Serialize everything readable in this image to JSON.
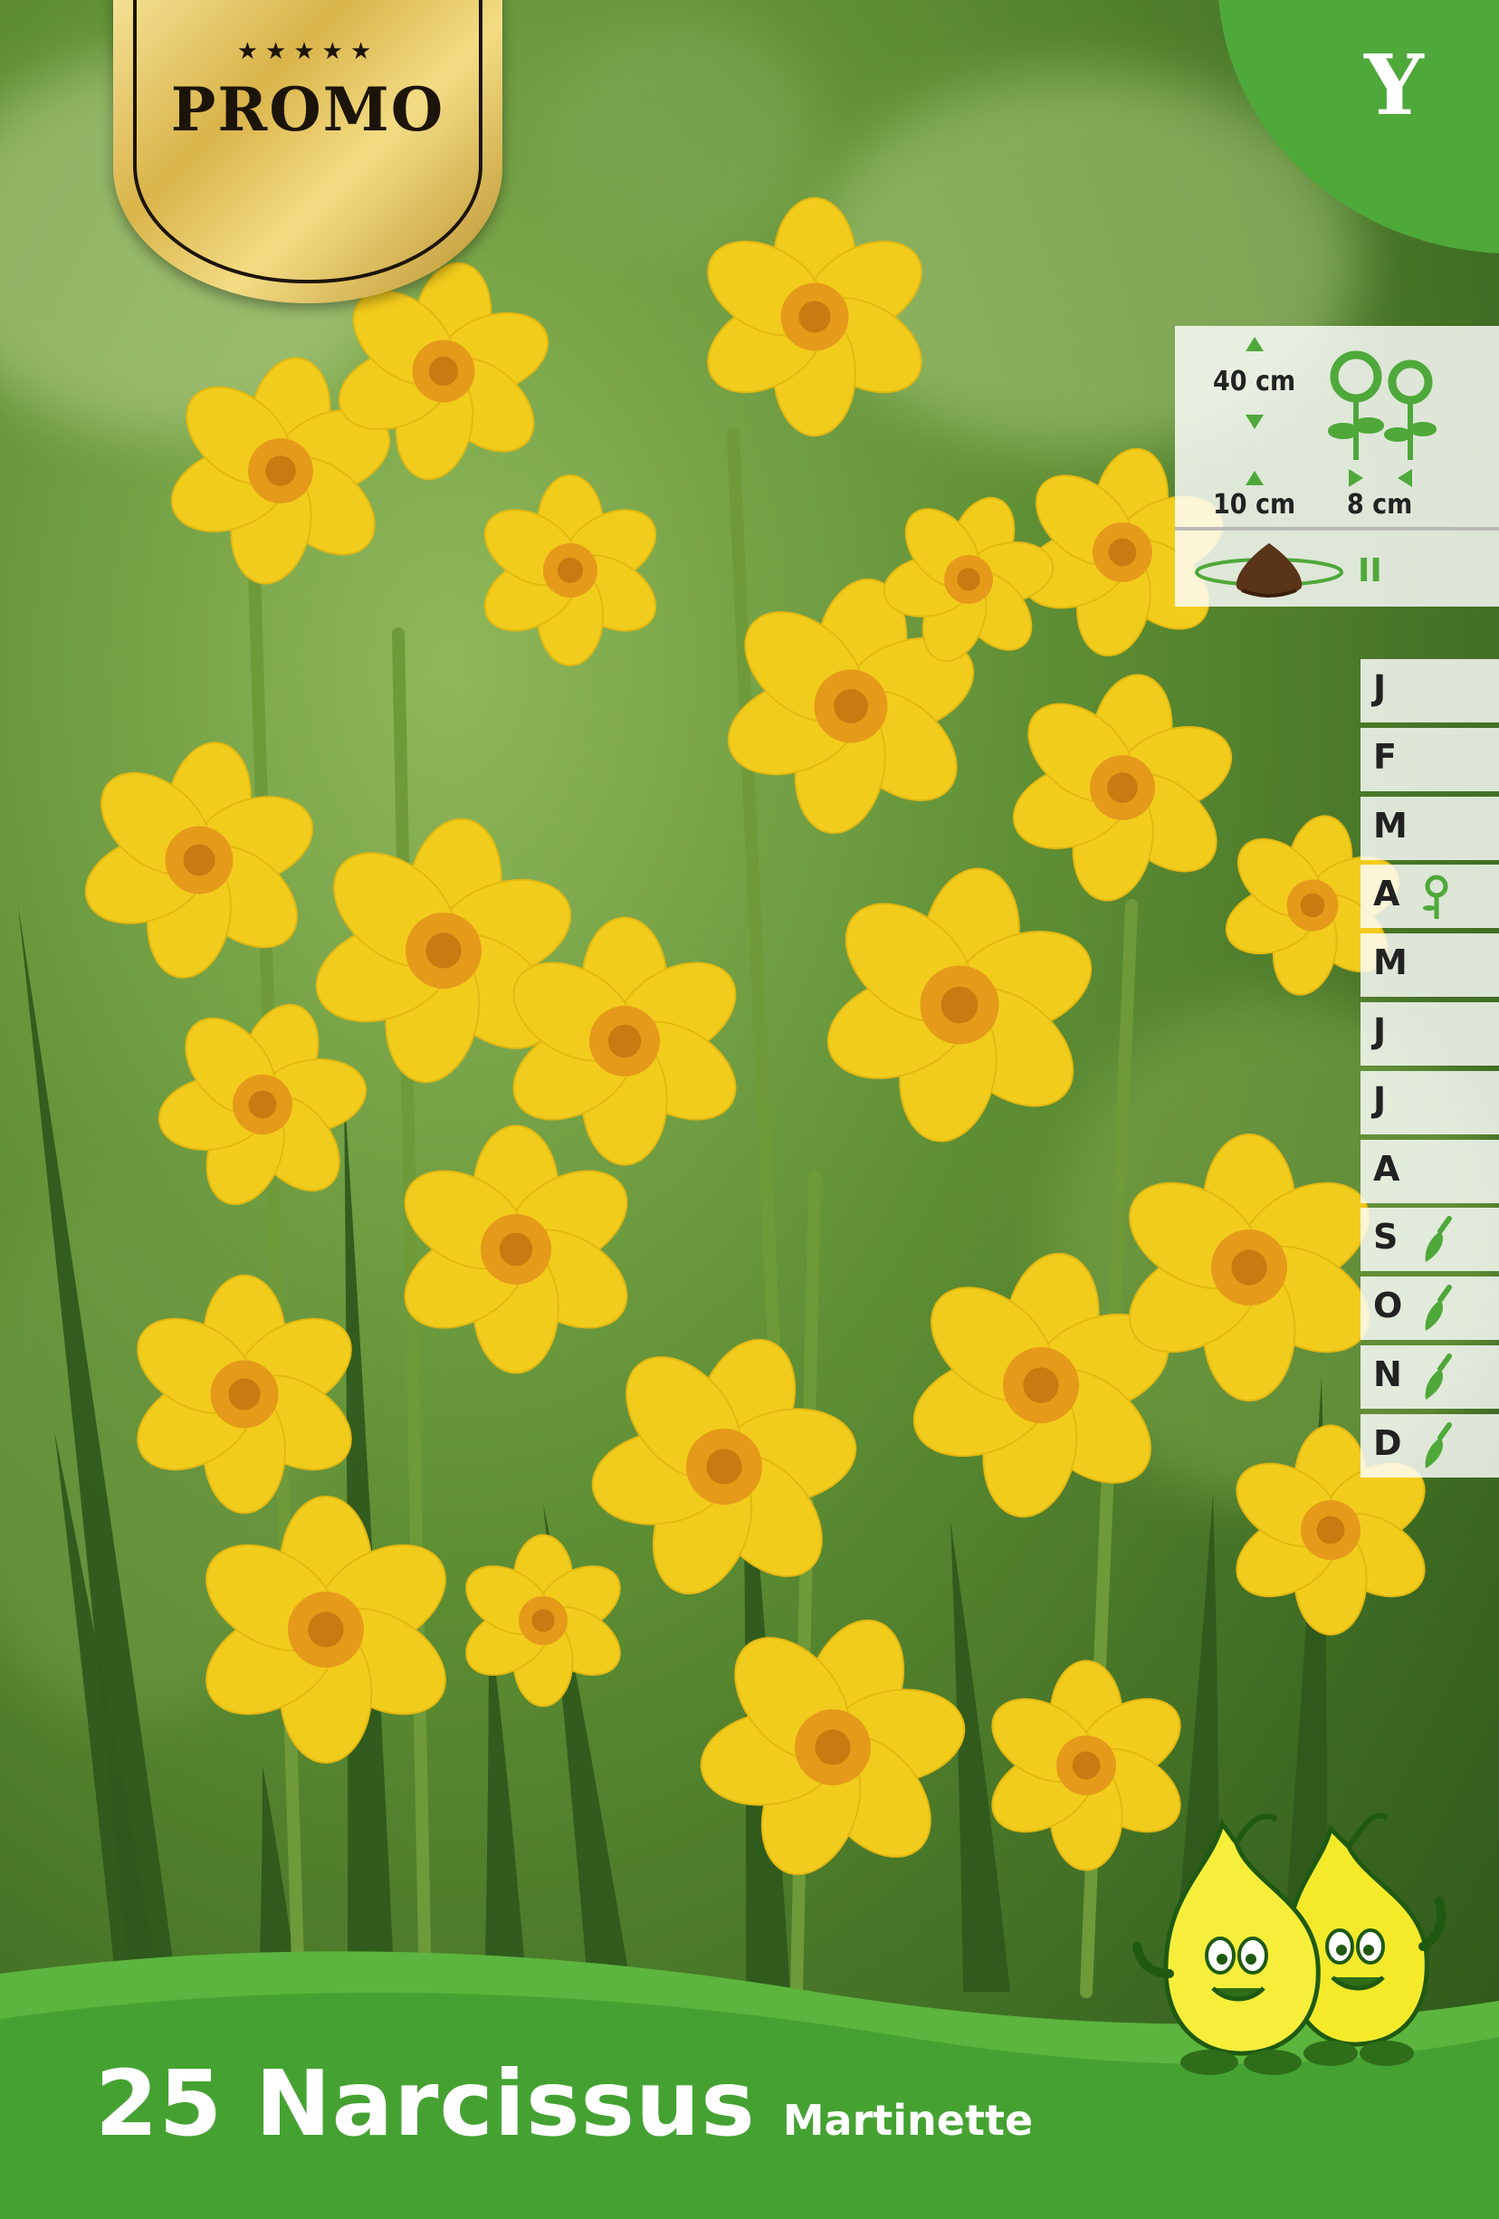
{
  "promo_badge": {
    "stars": "★★★★★",
    "label": "PROMO"
  },
  "corner_badge": {
    "letter": "Y",
    "color": "#4fa83a"
  },
  "planting_info": {
    "plant_height": "40 cm",
    "planting_depth": "10 cm",
    "plant_spacing": "8 cm",
    "hardiness": "II",
    "icons": [
      "height-arrows-icon",
      "flowers-icon",
      "spacing-arrows-icon",
      "bulb-icon"
    ]
  },
  "calendar": {
    "months": [
      "J",
      "F",
      "M",
      "A",
      "M",
      "J",
      "J",
      "A",
      "S",
      "O",
      "N",
      "D"
    ],
    "flowering_months": [
      "A"
    ],
    "planting_months": [
      "S",
      "O",
      "N",
      "D"
    ]
  },
  "product": {
    "quantity_name": "25 Narcissus",
    "variety": "Martinette"
  },
  "colors": {
    "petal_yellow": "#f2cc1c",
    "cup_orange": "#e59a1a",
    "leaf_green": "#2f5a1c",
    "band_green": "#4fa83a"
  }
}
